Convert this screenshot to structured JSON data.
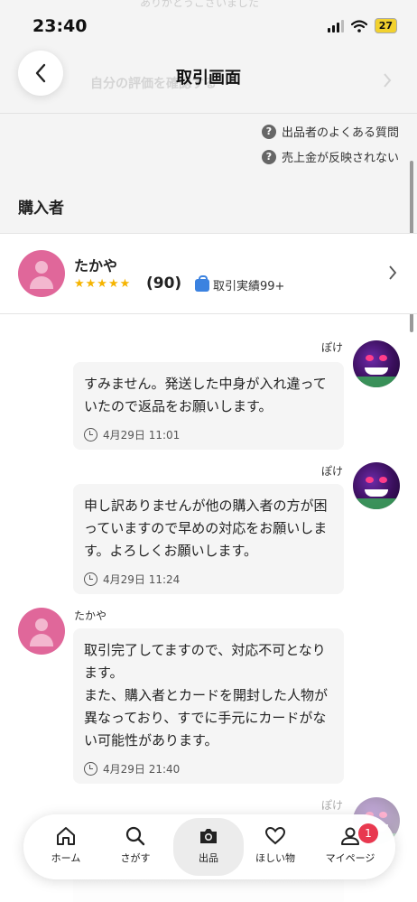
{
  "status_bar": {
    "time": "23:40",
    "battery": "27"
  },
  "header": {
    "title": "取引画面",
    "faded_row_text": "自分の評価を確認する",
    "faded_top_text": "ありがとうございました"
  },
  "help_links": [
    {
      "label": "出品者のよくある質問"
    },
    {
      "label": "売上金が反映されない"
    }
  ],
  "section": {
    "title": "購入者"
  },
  "buyer": {
    "name": "たかや",
    "rating_count": "(90)",
    "trade_badge": "取引実績99+",
    "stars": 4.5
  },
  "messages": [
    {
      "sender": "ぽけ",
      "text": "すみません。発送した中身が入れ違っていたので返品をお願いします。",
      "time": "4月29日 11:01"
    },
    {
      "sender": "ぽけ",
      "text": "申し訳ありませんが他の購入者の方が困っていますので早めの対応をお願いします。よろしくお願いします。",
      "time": "4月29日 11:24"
    },
    {
      "sender": "たかや",
      "text": "取引完了してますので、対応不可となります。\nまた、購入者とカードを開封した人物が異なっており、すでに手元にカードがない可能性があります。",
      "time": "4月29日 21:40"
    },
    {
      "sender": "ぽけ"
    }
  ],
  "tabbar": {
    "items": [
      {
        "label": "ホーム",
        "icon": "home-icon"
      },
      {
        "label": "さがす",
        "icon": "search-icon"
      },
      {
        "label": "出品",
        "icon": "camera-icon"
      },
      {
        "label": "ほしい物",
        "icon": "heart-icon"
      },
      {
        "label": "マイページ",
        "icon": "person-icon"
      }
    ],
    "notification_count": "1"
  }
}
